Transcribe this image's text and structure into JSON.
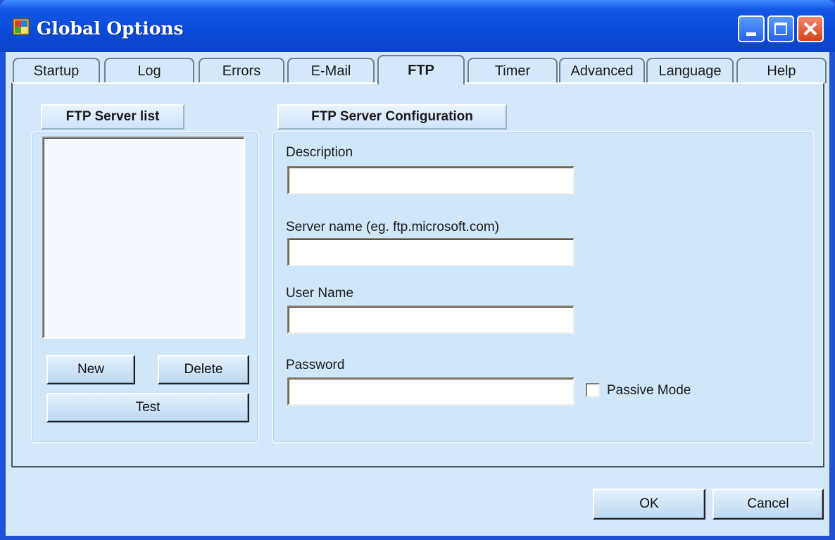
{
  "window": {
    "title": "Global Options",
    "controls": {
      "minimize": "minimize-icon",
      "maximize": "maximize-icon",
      "close": "close-icon"
    }
  },
  "tabs": [
    {
      "label": "Startup",
      "active": false
    },
    {
      "label": "Log",
      "active": false
    },
    {
      "label": "Errors",
      "active": false
    },
    {
      "label": "E-Mail",
      "active": false
    },
    {
      "label": "FTP",
      "active": true
    },
    {
      "label": "Timer",
      "active": false
    },
    {
      "label": "Advanced",
      "active": false
    },
    {
      "label": "Language",
      "active": false
    },
    {
      "label": "Help",
      "active": false
    }
  ],
  "server_list": {
    "header": "FTP Server list",
    "items": [],
    "buttons": {
      "new": "New",
      "delete": "Delete",
      "test": "Test"
    }
  },
  "config": {
    "header": "FTP Server Configuration",
    "description": {
      "label": "Description",
      "value": ""
    },
    "server_name": {
      "label": "Server name (eg. ftp.microsoft.com)",
      "value": ""
    },
    "user_name": {
      "label": "User Name",
      "value": ""
    },
    "password": {
      "label": "Password",
      "value": ""
    },
    "passive_mode": {
      "label": "Passive Mode",
      "checked": false
    }
  },
  "footer": {
    "ok": "OK",
    "cancel": "Cancel"
  },
  "colors": {
    "titlebar": "#0a4ad8",
    "dialog": "#d4e8fa",
    "close_button": "#d6421e"
  }
}
